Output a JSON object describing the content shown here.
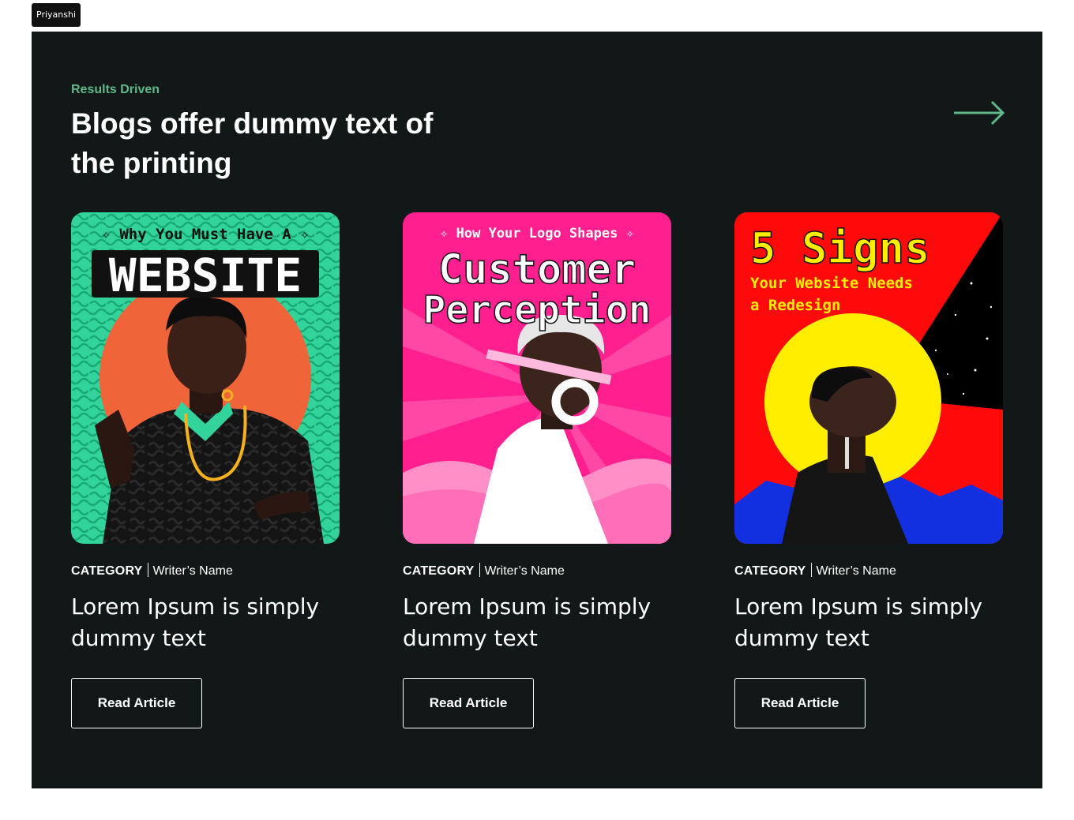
{
  "user_tag": "Priyanshi",
  "section": {
    "eyebrow": "Results Driven",
    "heading": "Blogs offer dummy text of the printing",
    "accent_color": "#5fb88a",
    "background": "#121817"
  },
  "nav": {
    "next_icon": "arrow-right-icon"
  },
  "cards": [
    {
      "category": "CATEGORY",
      "author": "Writer’s Name",
      "title": "Lorem Ipsum is simply dummy text",
      "button": "Read Article",
      "image": {
        "kicker": "✧ Why You Must Have A ✧",
        "headline": "WEBSITE",
        "palette": [
          "#33d49b",
          "#f0643a",
          "#111111"
        ]
      }
    },
    {
      "category": "CATEGORY",
      "author": "Writer’s Name",
      "title": "Lorem Ipsum is simply dummy text",
      "button": "Read Article",
      "image": {
        "kicker": "✧ How Your Logo Shapes ✧",
        "headline_1": "Customer",
        "headline_2": "Perception",
        "palette": [
          "#ff1f8e",
          "#ffffff",
          "#ff8fc6"
        ]
      }
    },
    {
      "category": "CATEGORY",
      "author": "Writer’s Name",
      "title": "Lorem Ipsum is simply dummy text",
      "button": "Read Article",
      "image": {
        "headline": "5 Signs",
        "sub_1": "Your Website Needs",
        "sub_2": "a Redesign",
        "palette": [
          "#ff0a0a",
          "#ffee00",
          "#1230e0",
          "#000000"
        ]
      }
    }
  ]
}
